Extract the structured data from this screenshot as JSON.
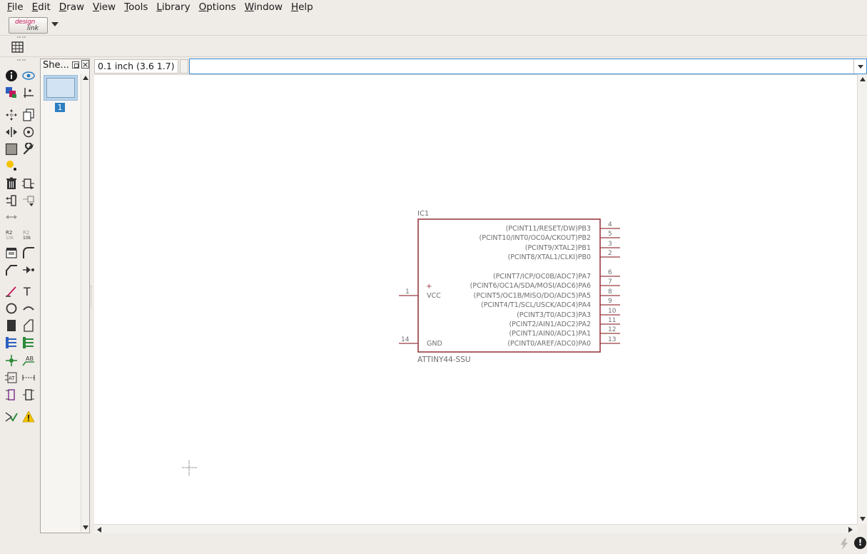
{
  "menu": [
    "File",
    "Edit",
    "Draw",
    "View",
    "Tools",
    "Library",
    "Options",
    "Window",
    "Help"
  ],
  "logo": {
    "line1": "design",
    "line2": "link"
  },
  "sheets": {
    "title": "She...",
    "close_glyph": "×",
    "current_sheet": "1"
  },
  "coordinates": "0.1 inch (3.6 1.7)",
  "command": {
    "value": "",
    "placeholder": ""
  },
  "status": {
    "text": ""
  },
  "schematic": {
    "name": "IC1",
    "value": "ATTINY44-SSU",
    "left_pins": [
      {
        "number": "1",
        "label": "VCC"
      },
      {
        "number": "14",
        "label": "GND"
      }
    ],
    "right_pins": [
      {
        "number": "4",
        "label": "(PCINT11/RESET/DW)PB3"
      },
      {
        "number": "5",
        "label": "(PCINT10/INT0/OC0A/CKOUT)PB2"
      },
      {
        "number": "3",
        "label": "(PCINT9/XTAL2)PB1"
      },
      {
        "number": "2",
        "label": "(PCINT8/XTAL1/CLKI)PB0"
      },
      {
        "number": "6",
        "label": "(PCINT7/ICP/OC0B/ADC7)PA7"
      },
      {
        "number": "7",
        "label": "(PCINT6/OC1A/SDA/MOSI/ADC6)PA6"
      },
      {
        "number": "8",
        "label": "(PCINT5/OC1B/MISO/DO/ADC5)PA5"
      },
      {
        "number": "9",
        "label": "(PCINT4/T1/SCL/USCK/ADC4)PA4"
      },
      {
        "number": "10",
        "label": "(PCINT3/T0/ADC3)PA3"
      },
      {
        "number": "11",
        "label": "(PCINT2/AIN1/ADC2)PA2"
      },
      {
        "number": "12",
        "label": "(PCINT1/AIN0/ADC1)PA1"
      },
      {
        "number": "13",
        "label": "(PCINT0/AREF/ADC0)PA0"
      }
    ],
    "plus_glyph": "+"
  },
  "colors": {
    "symbol": "#9b3a42",
    "pin_text": "#6e6e6e",
    "accent": "#2d7fc1",
    "warning": "#f5c400"
  },
  "icons": {
    "tools": [
      "info-icon",
      "show-icon",
      "display-layers-icon",
      "mark-icon",
      "move-icon",
      "copy-icon",
      "mirror-icon",
      "rotate-icon",
      "group-icon",
      "change-icon",
      "smash-icon",
      "delete-icon",
      "add-part-icon",
      "pinswap-icon",
      "gateswap-icon",
      "replace-icon",
      "name-icon",
      "value-icon",
      "split-icon",
      "miter-icon",
      "optimize-icon",
      "invoke-icon",
      "line-icon",
      "text-icon",
      "circle-icon",
      "arc-icon",
      "rectangle-icon",
      "polygon-icon",
      "bus-icon",
      "net-icon",
      "junction-icon",
      "label-icon",
      "attribute-icon",
      "dimension-icon",
      "frame-icon",
      "module-icon",
      "erc-icon",
      "errors-icon"
    ]
  }
}
